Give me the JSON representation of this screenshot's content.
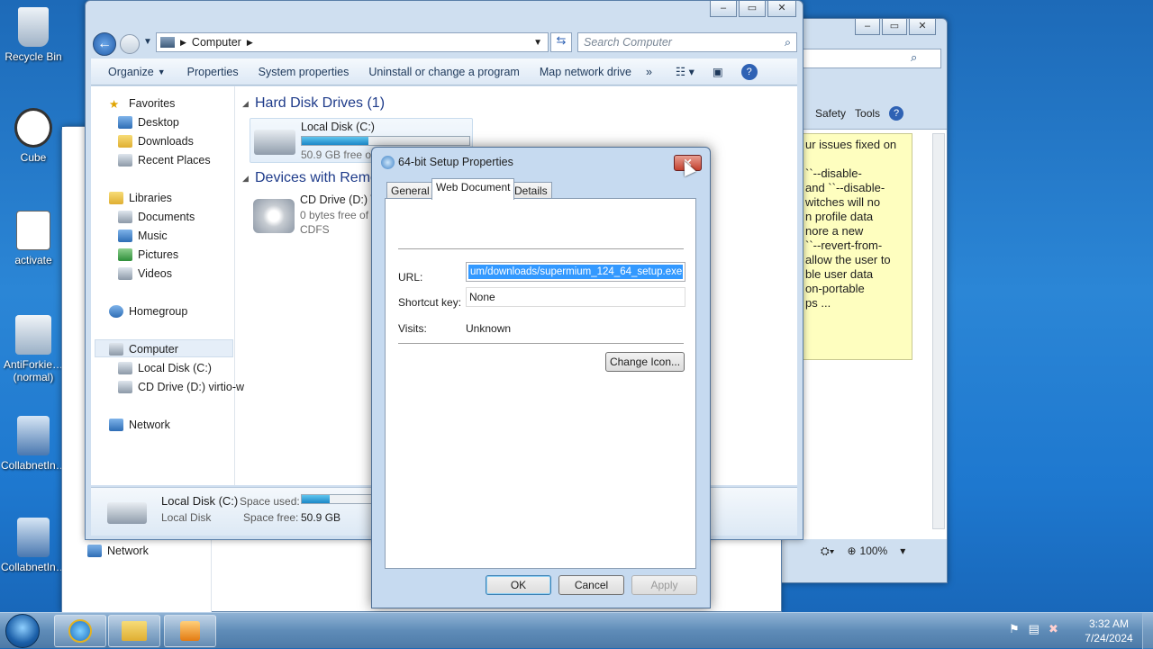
{
  "desktop": {
    "icons": [
      {
        "label": "Recycle Bin"
      },
      {
        "label": "Cube"
      },
      {
        "label": "activate"
      },
      {
        "label": "AntiForkie…",
        "sub": "(normal)"
      },
      {
        "label": "CollabnetIn…"
      },
      {
        "label": "CollabnetIn…"
      }
    ]
  },
  "explorer": {
    "breadcrumb": "Computer",
    "search_placeholder": "Search Computer",
    "toolbar": {
      "organize": "Organize",
      "properties": "Properties",
      "system_properties": "System properties",
      "uninstall": "Uninstall or change a program",
      "map_drive": "Map network drive",
      "more": "»"
    },
    "nav": {
      "favorites": "Favorites",
      "desktop": "Desktop",
      "downloads": "Downloads",
      "recent": "Recent Places",
      "libraries": "Libraries",
      "documents": "Documents",
      "music": "Music",
      "pictures": "Pictures",
      "videos": "Videos",
      "homegroup": "Homegroup",
      "computer": "Computer",
      "local_disk": "Local Disk (C:)",
      "cd_drive": "CD Drive (D:) virtio-w",
      "network": "Network"
    },
    "section_hdd": "Hard Disk Drives (1)",
    "section_devices": "Devices with Remo",
    "disk_c": {
      "name": "Local Disk (C:)",
      "free": "50.9 GB free of",
      "used_fraction": 0.4
    },
    "disk_d": {
      "name": "CD Drive (D:) \\",
      "free": "0 bytes free of",
      "fs": "CDFS"
    },
    "details": {
      "name": "Local Disk (C:)",
      "type": "Local Disk",
      "space_used_label": "Space used:",
      "space_free_label": "Space free:",
      "space_free": "50.9 GB"
    }
  },
  "behind_window": {
    "network": "Network"
  },
  "ie": {
    "safety": "Safety",
    "tools": "Tools",
    "zoom": "100%",
    "note_lines": [
      "ur issues fixed on",
      "",
      "``--disable-",
      "and ``--disable-",
      "witches will no",
      "n profile data",
      "nore a new",
      "``--revert-from-",
      "allow the user to",
      "ble user data",
      "on-portable",
      "ps ..."
    ]
  },
  "dialog": {
    "title": "64-bit Setup Properties",
    "tabs": [
      "General",
      "Web Document",
      "Details"
    ],
    "url_label": "URL:",
    "url_value": "um/downloads/supermium_124_64_setup.exe",
    "shortcut_label": "Shortcut key:",
    "shortcut_value": "None",
    "visits_label": "Visits:",
    "visits_value": "Unknown",
    "change_icon": "Change Icon...",
    "ok": "OK",
    "cancel": "Cancel",
    "apply": "Apply"
  },
  "taskbar": {
    "time": "3:32 AM",
    "date": "7/24/2024"
  }
}
